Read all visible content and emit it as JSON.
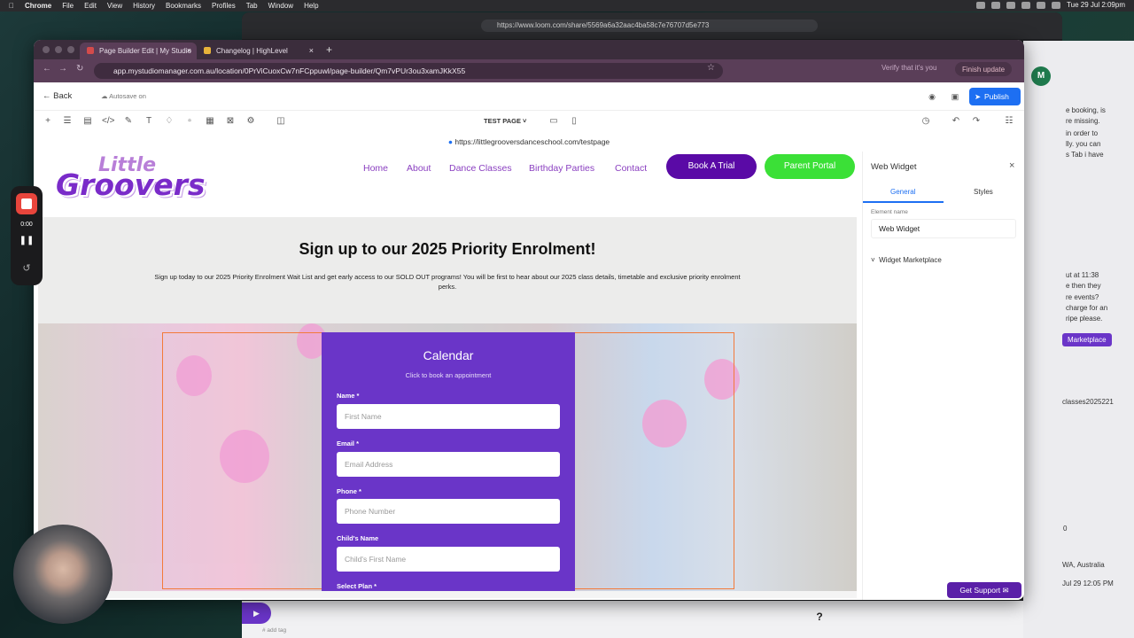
{
  "menubar": {
    "app": "Chrome",
    "items": [
      "File",
      "Edit",
      "View",
      "History",
      "Bookmarks",
      "Profiles",
      "Tab",
      "Window",
      "Help"
    ],
    "clock": "Tue 29 Jul  2:09pm"
  },
  "loom": {
    "url": "https://www.loom.com/share/5569a6a32aac4ba58c7e76707d5e773",
    "add_tag": "# add tag"
  },
  "right_window": {
    "lines": [
      "e booking, is",
      "re missing.",
      "in order to",
      "lly. you can",
      "s Tab i have",
      "ut at 11:38",
      "e then they",
      "re events?",
      "charge for an",
      "ripe please."
    ],
    "marketplace": "Marketplace",
    "classes": "classes2025221",
    "location": "WA, Australia",
    "date": "Jul 29 12:05 PM",
    "zero": "0",
    "avatar": "M"
  },
  "chrome": {
    "tabs": [
      {
        "title": "Page Builder Edit | My Studio",
        "active": true
      },
      {
        "title": "Changelog | HighLevel",
        "active": false
      }
    ],
    "address": "app.mystudiomanager.com.au/location/0PrViCuoxCw7nFCppuwl/page-builder/Qm7vPUr3ou3xamJKkX55",
    "verify": "Verify that it's you",
    "finish": "Finish update"
  },
  "builder": {
    "back": "Back",
    "autosave": "Autosave on",
    "publish": "Publish",
    "page_name": "TEST PAGE",
    "preview_url": "https://littlegrooversdanceschool.com/testpage"
  },
  "site": {
    "logo_top": "Little",
    "logo_bottom": "Groovers",
    "nav": [
      "Home",
      "About",
      "Dance Classes",
      "Birthday Parties",
      "Contact"
    ],
    "btn_trial": "Book A Trial",
    "btn_portal": "Parent Portal",
    "hero_title": "Sign up to our 2025 Priority Enrolment!",
    "hero_sub": "Sign up today to our 2025 Priority Enrolment Wait List and get early access to our SOLD OUT programs! You will be first to hear about our 2025 class details, timetable and exclusive priority enrolment perks.",
    "form": {
      "title": "Calendar",
      "subtitle": "Click to book an appointment",
      "fields": [
        {
          "label": "Name *",
          "placeholder": "First Name"
        },
        {
          "label": "Email *",
          "placeholder": "Email Address"
        },
        {
          "label": "Phone *",
          "placeholder": "Phone Number"
        },
        {
          "label": "Child's Name",
          "placeholder": "Child's First Name"
        }
      ],
      "next_label": "Select Plan *"
    }
  },
  "panel": {
    "title": "Web Widget",
    "tab_general": "General",
    "tab_styles": "Styles",
    "element_name_label": "Element name",
    "element_name_value": "Web Widget",
    "section": "Widget Marketplace"
  },
  "recorder": {
    "time": "0:00"
  },
  "support": "Get Support",
  "help": "?"
}
